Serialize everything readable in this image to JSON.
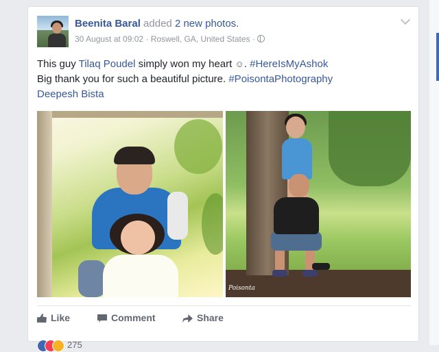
{
  "post": {
    "author": "Beenita Baral",
    "action": "added",
    "photo_count": "2 new photos.",
    "date": "30 August at 09:02",
    "separator": "·",
    "location": "Roswell, GA, United States",
    "text_line1_a": "This guy ",
    "tagged_person": "Tilaq Poudel",
    "text_line1_b": " simply won my heart ",
    "emoji": "☺",
    "text_line1_c": ". ",
    "hashtag1": "#HereIsMyAshok",
    "text_line2_a": "Big thank you for such a beautiful picture. ",
    "hashtag2": "#PoisontaPhotography",
    "tagged_person2": "Deepesh Bista",
    "watermark": "Poisonta"
  },
  "actions": {
    "like": "Like",
    "comment": "Comment",
    "share": "Share"
  },
  "reactions": {
    "count": "275"
  },
  "colors": {
    "link": "#365899",
    "meta": "#90949c",
    "action_text": "#606770"
  },
  "icons": [
    "globe-icon",
    "chevron-down-icon",
    "like-icon",
    "comment-icon",
    "share-icon"
  ]
}
